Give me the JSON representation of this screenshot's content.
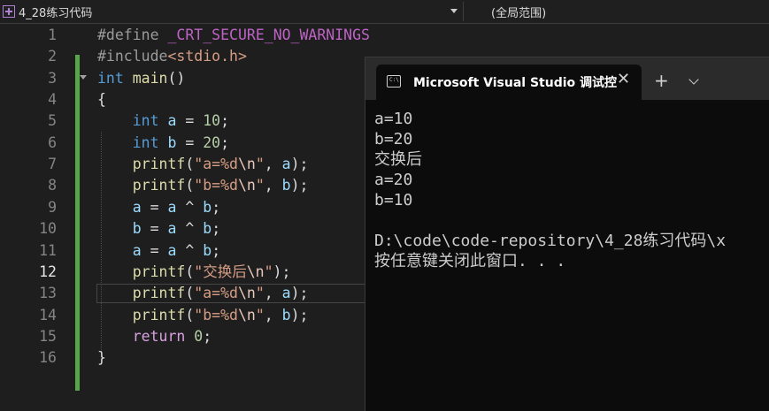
{
  "navbar": {
    "project": "4_28练习代码",
    "scope": "(全局范围)"
  },
  "editor": {
    "current_line": 12,
    "lines": [
      {
        "n": "1",
        "tokens": [
          {
            "t": "#define ",
            "c": "c-pre"
          },
          {
            "t": "_CRT_SECURE_NO_WARNINGS",
            "c": "c-macro"
          }
        ]
      },
      {
        "n": "2",
        "tokens": [
          {
            "t": "#include",
            "c": "c-pre"
          },
          {
            "t": "<stdio.h>",
            "c": "c-inc"
          }
        ]
      },
      {
        "n": "3",
        "fold": true,
        "tokens": [
          {
            "t": "int ",
            "c": "c-kw"
          },
          {
            "t": "main",
            "c": "c-fn"
          },
          {
            "t": "()",
            "c": "c-plain"
          }
        ]
      },
      {
        "n": "4",
        "tokens": [
          {
            "t": "{",
            "c": "c-plain"
          }
        ]
      },
      {
        "n": "5",
        "tokens": [
          {
            "t": "    ",
            "c": "c-plain"
          },
          {
            "t": "int ",
            "c": "c-kw"
          },
          {
            "t": "a",
            "c": "c-var"
          },
          {
            "t": " = ",
            "c": "c-plain"
          },
          {
            "t": "10",
            "c": "c-num"
          },
          {
            "t": ";",
            "c": "c-plain"
          }
        ]
      },
      {
        "n": "6",
        "tokens": [
          {
            "t": "    ",
            "c": "c-plain"
          },
          {
            "t": "int ",
            "c": "c-kw"
          },
          {
            "t": "b",
            "c": "c-var"
          },
          {
            "t": " = ",
            "c": "c-plain"
          },
          {
            "t": "20",
            "c": "c-num"
          },
          {
            "t": ";",
            "c": "c-plain"
          }
        ]
      },
      {
        "n": "7",
        "tokens": [
          {
            "t": "    ",
            "c": "c-plain"
          },
          {
            "t": "printf",
            "c": "c-fn"
          },
          {
            "t": "(",
            "c": "c-plain"
          },
          {
            "t": "\"a=%d",
            "c": "c-str"
          },
          {
            "t": "\\n",
            "c": "c-esc"
          },
          {
            "t": "\"",
            "c": "c-str"
          },
          {
            "t": ", ",
            "c": "c-plain"
          },
          {
            "t": "a",
            "c": "c-var"
          },
          {
            "t": ");",
            "c": "c-plain"
          }
        ]
      },
      {
        "n": "8",
        "tokens": [
          {
            "t": "    ",
            "c": "c-plain"
          },
          {
            "t": "printf",
            "c": "c-fn"
          },
          {
            "t": "(",
            "c": "c-plain"
          },
          {
            "t": "\"b=%d",
            "c": "c-str"
          },
          {
            "t": "\\n",
            "c": "c-esc"
          },
          {
            "t": "\"",
            "c": "c-str"
          },
          {
            "t": ", ",
            "c": "c-plain"
          },
          {
            "t": "b",
            "c": "c-var"
          },
          {
            "t": ");",
            "c": "c-plain"
          }
        ]
      },
      {
        "n": "9",
        "tokens": [
          {
            "t": "    ",
            "c": "c-plain"
          },
          {
            "t": "a",
            "c": "c-var"
          },
          {
            "t": " = ",
            "c": "c-plain"
          },
          {
            "t": "a",
            "c": "c-var"
          },
          {
            "t": " ^ ",
            "c": "c-plain"
          },
          {
            "t": "b",
            "c": "c-var"
          },
          {
            "t": ";",
            "c": "c-plain"
          }
        ]
      },
      {
        "n": "10",
        "tokens": [
          {
            "t": "    ",
            "c": "c-plain"
          },
          {
            "t": "b",
            "c": "c-var"
          },
          {
            "t": " = ",
            "c": "c-plain"
          },
          {
            "t": "a",
            "c": "c-var"
          },
          {
            "t": " ^ ",
            "c": "c-plain"
          },
          {
            "t": "b",
            "c": "c-var"
          },
          {
            "t": ";",
            "c": "c-plain"
          }
        ]
      },
      {
        "n": "11",
        "tokens": [
          {
            "t": "    ",
            "c": "c-plain"
          },
          {
            "t": "a",
            "c": "c-var"
          },
          {
            "t": " = ",
            "c": "c-plain"
          },
          {
            "t": "a",
            "c": "c-var"
          },
          {
            "t": " ^ ",
            "c": "c-plain"
          },
          {
            "t": "b",
            "c": "c-var"
          },
          {
            "t": ";",
            "c": "c-plain"
          }
        ]
      },
      {
        "n": "12",
        "tokens": [
          {
            "t": "    ",
            "c": "c-plain"
          },
          {
            "t": "printf",
            "c": "c-fn"
          },
          {
            "t": "(",
            "c": "c-plain"
          },
          {
            "t": "\"交换后",
            "c": "c-str"
          },
          {
            "t": "\\n",
            "c": "c-esc"
          },
          {
            "t": "\"",
            "c": "c-str"
          },
          {
            "t": ");",
            "c": "c-plain"
          }
        ]
      },
      {
        "n": "13",
        "tokens": [
          {
            "t": "    ",
            "c": "c-plain"
          },
          {
            "t": "printf",
            "c": "c-fn"
          },
          {
            "t": "(",
            "c": "c-plain"
          },
          {
            "t": "\"a=%d",
            "c": "c-str"
          },
          {
            "t": "\\n",
            "c": "c-esc"
          },
          {
            "t": "\"",
            "c": "c-str"
          },
          {
            "t": ", ",
            "c": "c-plain"
          },
          {
            "t": "a",
            "c": "c-var"
          },
          {
            "t": ");",
            "c": "c-plain"
          }
        ]
      },
      {
        "n": "14",
        "tokens": [
          {
            "t": "    ",
            "c": "c-plain"
          },
          {
            "t": "printf",
            "c": "c-fn"
          },
          {
            "t": "(",
            "c": "c-plain"
          },
          {
            "t": "\"b=%d",
            "c": "c-str"
          },
          {
            "t": "\\n",
            "c": "c-esc"
          },
          {
            "t": "\"",
            "c": "c-str"
          },
          {
            "t": ", ",
            "c": "c-plain"
          },
          {
            "t": "b",
            "c": "c-var"
          },
          {
            "t": ");",
            "c": "c-plain"
          }
        ]
      },
      {
        "n": "15",
        "tokens": [
          {
            "t": "    ",
            "c": "c-plain"
          },
          {
            "t": "return ",
            "c": "c-ret"
          },
          {
            "t": "0",
            "c": "c-num"
          },
          {
            "t": ";",
            "c": "c-plain"
          }
        ]
      },
      {
        "n": "16",
        "tokens": [
          {
            "t": "}",
            "c": "c-plain"
          }
        ]
      }
    ]
  },
  "terminal": {
    "tab_icon": "console-icon",
    "tab_icon_text": "C:\\",
    "tab_title": "Microsoft Visual Studio 调试控",
    "close_glyph": "✕",
    "new_tab_glyph": "+",
    "output": [
      "a=10",
      "b=20",
      "交换后",
      "a=20",
      "b=10",
      "",
      "D:\\code\\code-repository\\4_28练习代码\\x",
      "按任意键关闭此窗口. . ."
    ]
  }
}
